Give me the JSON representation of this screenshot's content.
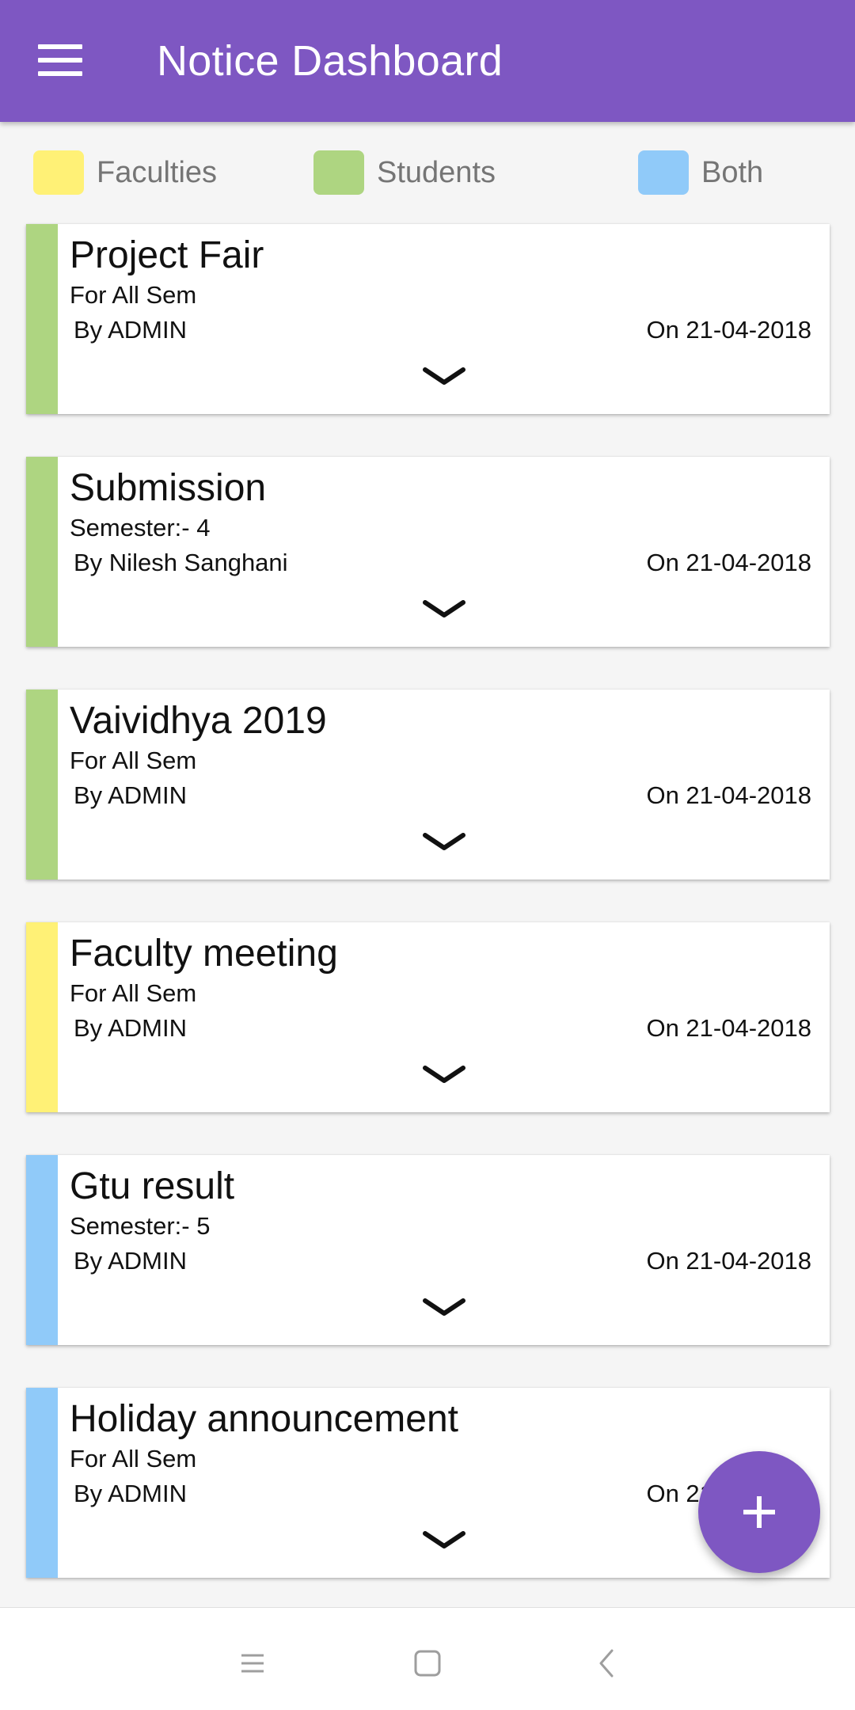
{
  "app_bar": {
    "title": "Notice Dashboard",
    "color": "#7e57c2",
    "menu_icon": "hamburger-menu-icon"
  },
  "legend": [
    {
      "label": "Faculties",
      "color": "#fff176"
    },
    {
      "label": "Students",
      "color": "#aed581"
    },
    {
      "label": "Both",
      "color": "#90caf9"
    }
  ],
  "notices": [
    {
      "title": "Project Fair",
      "semester": "For All Sem",
      "author": "By ADMIN",
      "date": "On 21-04-2018",
      "audience": "Students",
      "color": "#aed581"
    },
    {
      "title": "Submission",
      "semester": "Semester:- 4",
      "author": "By Nilesh Sanghani",
      "date": "On 21-04-2018",
      "audience": "Students",
      "color": "#aed581"
    },
    {
      "title": "Vaividhya 2019",
      "semester": "For All Sem",
      "author": "By ADMIN",
      "date": "On 21-04-2018",
      "audience": "Students",
      "color": "#aed581"
    },
    {
      "title": "Faculty meeting",
      "semester": "For All Sem",
      "author": "By ADMIN",
      "date": "On 21-04-2018",
      "audience": "Faculties",
      "color": "#fff176"
    },
    {
      "title": "Gtu result",
      "semester": "Semester:- 5",
      "author": "By ADMIN",
      "date": "On 21-04-2018",
      "audience": "Both",
      "color": "#90caf9"
    },
    {
      "title": "Holiday announcement",
      "semester": "For All Sem",
      "author": "By ADMIN",
      "date": "On 21-04-2018",
      "audience": "Both",
      "color": "#90caf9"
    }
  ],
  "fab": {
    "icon": "plus-icon",
    "color": "#7e57c2"
  },
  "nav_bar": {
    "icons": [
      "recent-apps-icon",
      "home-icon",
      "back-icon"
    ]
  }
}
